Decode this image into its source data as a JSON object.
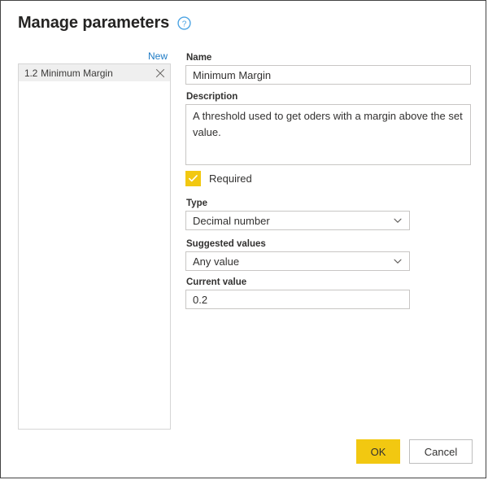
{
  "dialog": {
    "title": "Manage parameters",
    "help_icon": "help-circle-icon"
  },
  "left_pane": {
    "new_label": "New",
    "remove_icon": "close-icon",
    "items": [
      {
        "type_icon": "1.2",
        "label": "Minimum Margin",
        "selected": true
      }
    ]
  },
  "form": {
    "name": {
      "label": "Name",
      "value": "Minimum Margin",
      "placeholder": ""
    },
    "description": {
      "label": "Description",
      "value": "A threshold used to get oders with a margin above the set value.",
      "placeholder": ""
    },
    "required": {
      "label": "Required",
      "checked": true,
      "check_icon": "checkmark-icon"
    },
    "type": {
      "label": "Type",
      "value": "Decimal number",
      "chevron_icon": "chevron-down-icon"
    },
    "suggested_values": {
      "label": "Suggested values",
      "value": "Any value",
      "chevron_icon": "chevron-down-icon"
    },
    "current_value": {
      "label": "Current value",
      "value": "0.2",
      "placeholder": ""
    }
  },
  "footer": {
    "ok_label": "OK",
    "cancel_label": "Cancel"
  },
  "colors": {
    "accent_yellow": "#f2c811",
    "link_blue": "#1e7bc5",
    "text": "#323130",
    "border": "#c8c6c4"
  }
}
